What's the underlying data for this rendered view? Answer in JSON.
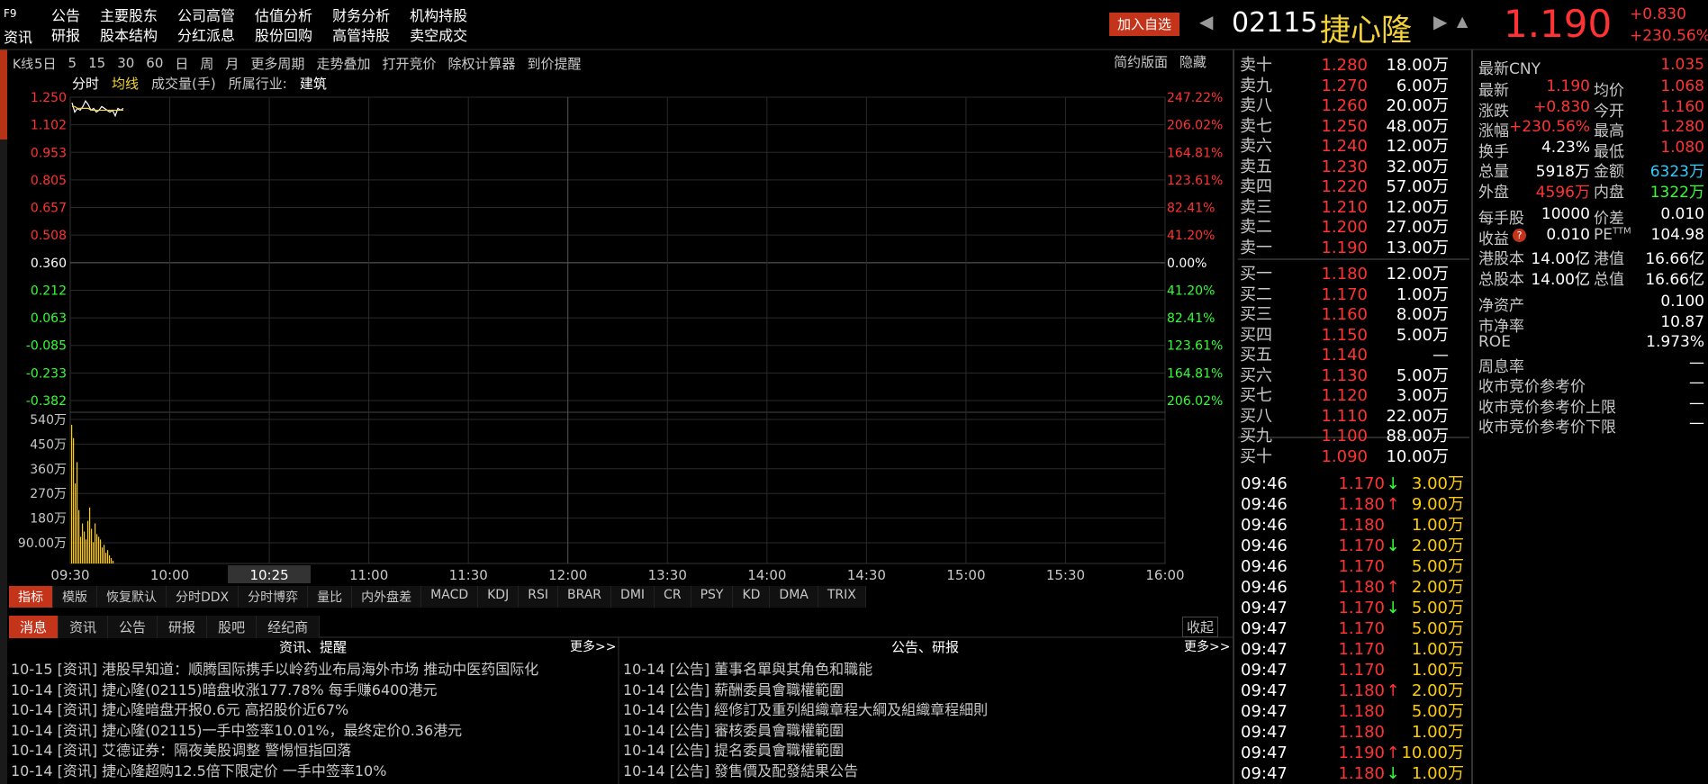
{
  "top_nav": {
    "f9": "F9",
    "zixun": "资讯",
    "row1": [
      "公告",
      "主要股东",
      "公司高管",
      "估值分析",
      "财务分析",
      "机构持股"
    ],
    "row2": [
      "研报",
      "股本结构",
      "分红派息",
      "股份回购",
      "高管持股",
      "卖空成交"
    ]
  },
  "header": {
    "add_btn": "加入自选",
    "code": "02115",
    "name": "捷心隆",
    "price": "1.190",
    "change": "+0.830",
    "change_pct": "+230.56%"
  },
  "toolbar": {
    "items": [
      "5日",
      "5",
      "15",
      "30",
      "60",
      "日",
      "周",
      "月",
      "更多周期",
      "走势叠加",
      "打开竞价",
      "除权计算器",
      "到价提醒"
    ],
    "k_label": "K线",
    "simple": "简约版面",
    "hide": "隐藏"
  },
  "chart_sub": {
    "fenshi": "分时",
    "junxian": "均线",
    "volume": "成交量(手)",
    "industry_label": "所属行业:",
    "industry": "建筑"
  },
  "chart_data": {
    "type": "line",
    "y_left": [
      "1.250",
      "1.102",
      "0.953",
      "0.805",
      "0.657",
      "0.508",
      "0.360",
      "0.212",
      "0.063",
      "-0.085",
      "-0.233",
      "-0.382"
    ],
    "y_right": [
      "247.22%",
      "206.02%",
      "164.81%",
      "123.61%",
      "82.41%",
      "41.20%",
      "0.00%",
      "41.20%",
      "82.41%",
      "123.61%",
      "164.81%",
      "206.02%"
    ],
    "vol_ticks": [
      "540万",
      "450万",
      "360万",
      "270万",
      "180万",
      "90.00万"
    ],
    "x_ticks": [
      "09:30",
      "10:00",
      "10:25",
      "11:00",
      "11:30",
      "12:00",
      "13:30",
      "14:00",
      "14:30",
      "15:00",
      "15:30",
      "16:00"
    ],
    "price_series": [
      1.22,
      1.17,
      1.19,
      1.18,
      1.2,
      1.23,
      1.21,
      1.18,
      1.19,
      1.17,
      1.18,
      1.2,
      1.19,
      1.18,
      1.17,
      1.18,
      1.15,
      1.19,
      1.18,
      1.19
    ],
    "avg_series": [
      1.2,
      1.2,
      1.19,
      1.19,
      1.19,
      1.19,
      1.19,
      1.18,
      1.18,
      1.18,
      1.18,
      1.18,
      1.18,
      1.18,
      1.18,
      1.18,
      1.18,
      1.18,
      1.18,
      1.18
    ],
    "volumes": [
      520,
      470,
      300,
      380,
      200,
      100,
      150,
      120,
      90,
      160,
      210,
      130,
      80,
      150,
      110,
      100,
      90,
      60,
      70,
      40,
      50,
      30,
      20,
      10
    ],
    "ylim_price": [
      -0.382,
      1.25
    ],
    "ylim_volume": [
      0,
      540
    ]
  },
  "bottom_tabs": [
    "指标",
    "模版",
    "恢复默认",
    "分时DDX",
    "分时博弈",
    "量比",
    "内外盘差",
    "MACD",
    "KDJ",
    "RSI",
    "BRAR",
    "DMI",
    "CR",
    "PSY",
    "KD",
    "DMA",
    "TRIX"
  ],
  "msg_tabs": [
    "消息",
    "资讯",
    "公告",
    "研报",
    "股吧",
    "经纪商"
  ],
  "collapse": "收起",
  "news_left": {
    "title": "资讯、提醒",
    "more": "更多>>",
    "items": [
      "10-15 [资讯] 港股早知道：顺腾国际携手以岭药业布局海外市场 推动中医药国际化",
      "10-14 [资讯] 捷心隆(02115)暗盘收涨177.78% 每手赚6400港元",
      "10-14 [资讯] 捷心隆暗盘开报0.6元 高招股价近67%",
      "10-14 [资讯] 捷心隆(02115)一手中签率10.01%，最终定价0.36港元",
      "10-14 [资讯] 艾德证券：隔夜美股调整 警惕恒指回落",
      "10-14 [资讯] 捷心隆超购12.5倍下限定价 一手中签率10%"
    ]
  },
  "news_right": {
    "title": "公告、研报",
    "more": "更多>>",
    "items": [
      "10-14 [公告] 董事名單與其角色和職能",
      "10-14 [公告] 薪酬委員會職權範圍",
      "10-14 [公告] 經修訂及重列組織章程大綱及組織章程細則",
      "10-14 [公告] 審核委員會職權範圍",
      "10-14 [公告] 提名委員會職權範圍",
      "10-14 [公告] 發售價及配發結果公告"
    ]
  },
  "order_book": {
    "sells": [
      {
        "label": "卖十",
        "price": "1.280",
        "vol": "18.00万"
      },
      {
        "label": "卖九",
        "price": "1.270",
        "vol": "6.00万"
      },
      {
        "label": "卖八",
        "price": "1.260",
        "vol": "20.00万"
      },
      {
        "label": "卖七",
        "price": "1.250",
        "vol": "48.00万"
      },
      {
        "label": "卖六",
        "price": "1.240",
        "vol": "12.00万"
      },
      {
        "label": "卖五",
        "price": "1.230",
        "vol": "32.00万"
      },
      {
        "label": "卖四",
        "price": "1.220",
        "vol": "57.00万"
      },
      {
        "label": "卖三",
        "price": "1.210",
        "vol": "12.00万"
      },
      {
        "label": "卖二",
        "price": "1.200",
        "vol": "27.00万"
      },
      {
        "label": "卖一",
        "price": "1.190",
        "vol": "13.00万"
      }
    ],
    "buys": [
      {
        "label": "买一",
        "price": "1.180",
        "vol": "12.00万"
      },
      {
        "label": "买二",
        "price": "1.170",
        "vol": "1.00万"
      },
      {
        "label": "买三",
        "price": "1.160",
        "vol": "8.00万"
      },
      {
        "label": "买四",
        "price": "1.150",
        "vol": "5.00万"
      },
      {
        "label": "买五",
        "price": "1.140",
        "vol": "—"
      },
      {
        "label": "买六",
        "price": "1.130",
        "vol": "5.00万"
      },
      {
        "label": "买七",
        "price": "1.120",
        "vol": "3.00万"
      },
      {
        "label": "买八",
        "price": "1.110",
        "vol": "22.00万"
      },
      {
        "label": "买九",
        "price": "1.100",
        "vol": "88.00万"
      },
      {
        "label": "买十",
        "price": "1.090",
        "vol": "10.00万"
      }
    ]
  },
  "ticks": [
    {
      "t": "09:46",
      "p": "1.170",
      "dir": "down",
      "v": "3.00万"
    },
    {
      "t": "09:46",
      "p": "1.180",
      "dir": "up",
      "v": "9.00万"
    },
    {
      "t": "09:46",
      "p": "1.180",
      "dir": "",
      "v": "1.00万"
    },
    {
      "t": "09:46",
      "p": "1.170",
      "dir": "down",
      "v": "2.00万"
    },
    {
      "t": "09:46",
      "p": "1.170",
      "dir": "",
      "v": "5.00万"
    },
    {
      "t": "09:46",
      "p": "1.180",
      "dir": "up",
      "v": "2.00万"
    },
    {
      "t": "09:47",
      "p": "1.170",
      "dir": "down",
      "v": "5.00万"
    },
    {
      "t": "09:47",
      "p": "1.170",
      "dir": "",
      "v": "5.00万"
    },
    {
      "t": "09:47",
      "p": "1.170",
      "dir": "",
      "v": "1.00万"
    },
    {
      "t": "09:47",
      "p": "1.170",
      "dir": "",
      "v": "1.00万"
    },
    {
      "t": "09:47",
      "p": "1.180",
      "dir": "up",
      "v": "2.00万"
    },
    {
      "t": "09:47",
      "p": "1.180",
      "dir": "",
      "v": "5.00万"
    },
    {
      "t": "09:47",
      "p": "1.180",
      "dir": "",
      "v": "1.00万"
    },
    {
      "t": "09:47",
      "p": "1.190",
      "dir": "up",
      "v": "10.00万"
    },
    {
      "t": "09:47",
      "p": "1.180",
      "dir": "down",
      "v": "1.00万"
    }
  ],
  "info": {
    "latest_cny_label": "最新CNY",
    "latest_cny": "1.035",
    "rows": [
      [
        "最新",
        "1.190",
        "均价",
        "1.068"
      ],
      [
        "涨跌",
        "+0.830",
        "今开",
        "1.160"
      ],
      [
        "涨幅",
        "+230.56%",
        "最高",
        "1.280"
      ],
      [
        "换手",
        "4.23%",
        "最低",
        "1.080"
      ],
      [
        "总量",
        "5918万",
        "金额",
        "6323万"
      ],
      [
        "外盘",
        "4596万",
        "内盘",
        "1322万"
      ]
    ],
    "rows2": [
      [
        "每手股",
        "10000",
        "价差",
        "0.010"
      ],
      [
        "收益",
        "0.010",
        "PE",
        "104.98"
      ],
      [
        "港股本",
        "14.00亿",
        "港值",
        "16.66亿"
      ],
      [
        "总股本",
        "14.00亿",
        "总值",
        "16.66亿"
      ]
    ],
    "single": [
      [
        "净资产",
        "0.100"
      ],
      [
        "市净率",
        "10.87"
      ],
      [
        "ROE",
        "1.973%"
      ],
      [
        "周息率",
        "—"
      ],
      [
        "收市竞价参考价",
        "—"
      ],
      [
        "收市竞价参考价上限",
        "—"
      ],
      [
        "收市竞价参考价下限",
        "—"
      ]
    ],
    "pe_sup": "TTM"
  },
  "colors": {
    "up": "#ff3333",
    "down": "#33ff33",
    "accent": "#c4341a",
    "name": "#f3d23a",
    "volume": "#ffcc00"
  }
}
